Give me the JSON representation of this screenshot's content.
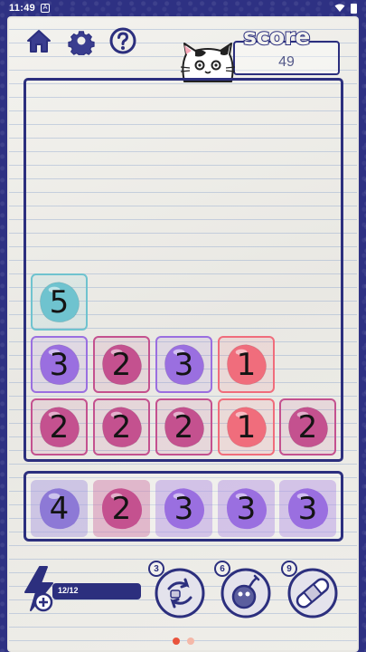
{
  "status_bar": {
    "time": "11:49",
    "notification_badge": "A"
  },
  "header": {
    "icons": [
      "home-icon",
      "gear-icon",
      "help-icon"
    ],
    "score_label": "score",
    "score_value": "49"
  },
  "colors": {
    "ink": "#2c2f7e",
    "teal": "#6fc3cf",
    "purple": "#9a6fe0",
    "magenta": "#c4518f",
    "pink": "#f06d7c",
    "lavender": "#8d79d6"
  },
  "board": {
    "tiles": [
      {
        "value": "5",
        "color": "teal"
      },
      {
        "value": "3",
        "color": "purple"
      },
      {
        "value": "2",
        "color": "magenta"
      },
      {
        "value": "3",
        "color": "purple"
      },
      {
        "value": "1",
        "color": "pink"
      },
      {
        "value": "2",
        "color": "magenta"
      },
      {
        "value": "2",
        "color": "magenta"
      },
      {
        "value": "2",
        "color": "magenta"
      },
      {
        "value": "1",
        "color": "pink"
      },
      {
        "value": "2",
        "color": "magenta"
      }
    ]
  },
  "tray": {
    "tiles": [
      {
        "value": "4",
        "color": "lavender"
      },
      {
        "value": "2",
        "color": "magenta"
      },
      {
        "value": "3",
        "color": "purple"
      },
      {
        "value": "3",
        "color": "purple"
      },
      {
        "value": "3",
        "color": "purple"
      }
    ]
  },
  "energy": {
    "label": "12/12",
    "fill": 1.0
  },
  "powerups": [
    {
      "name": "shuffle",
      "icon": "shuffle-icon",
      "cost": "3"
    },
    {
      "name": "bomb",
      "icon": "bomb-icon",
      "cost": "6"
    },
    {
      "name": "bandage",
      "icon": "bandage-icon",
      "cost": "9"
    }
  ]
}
